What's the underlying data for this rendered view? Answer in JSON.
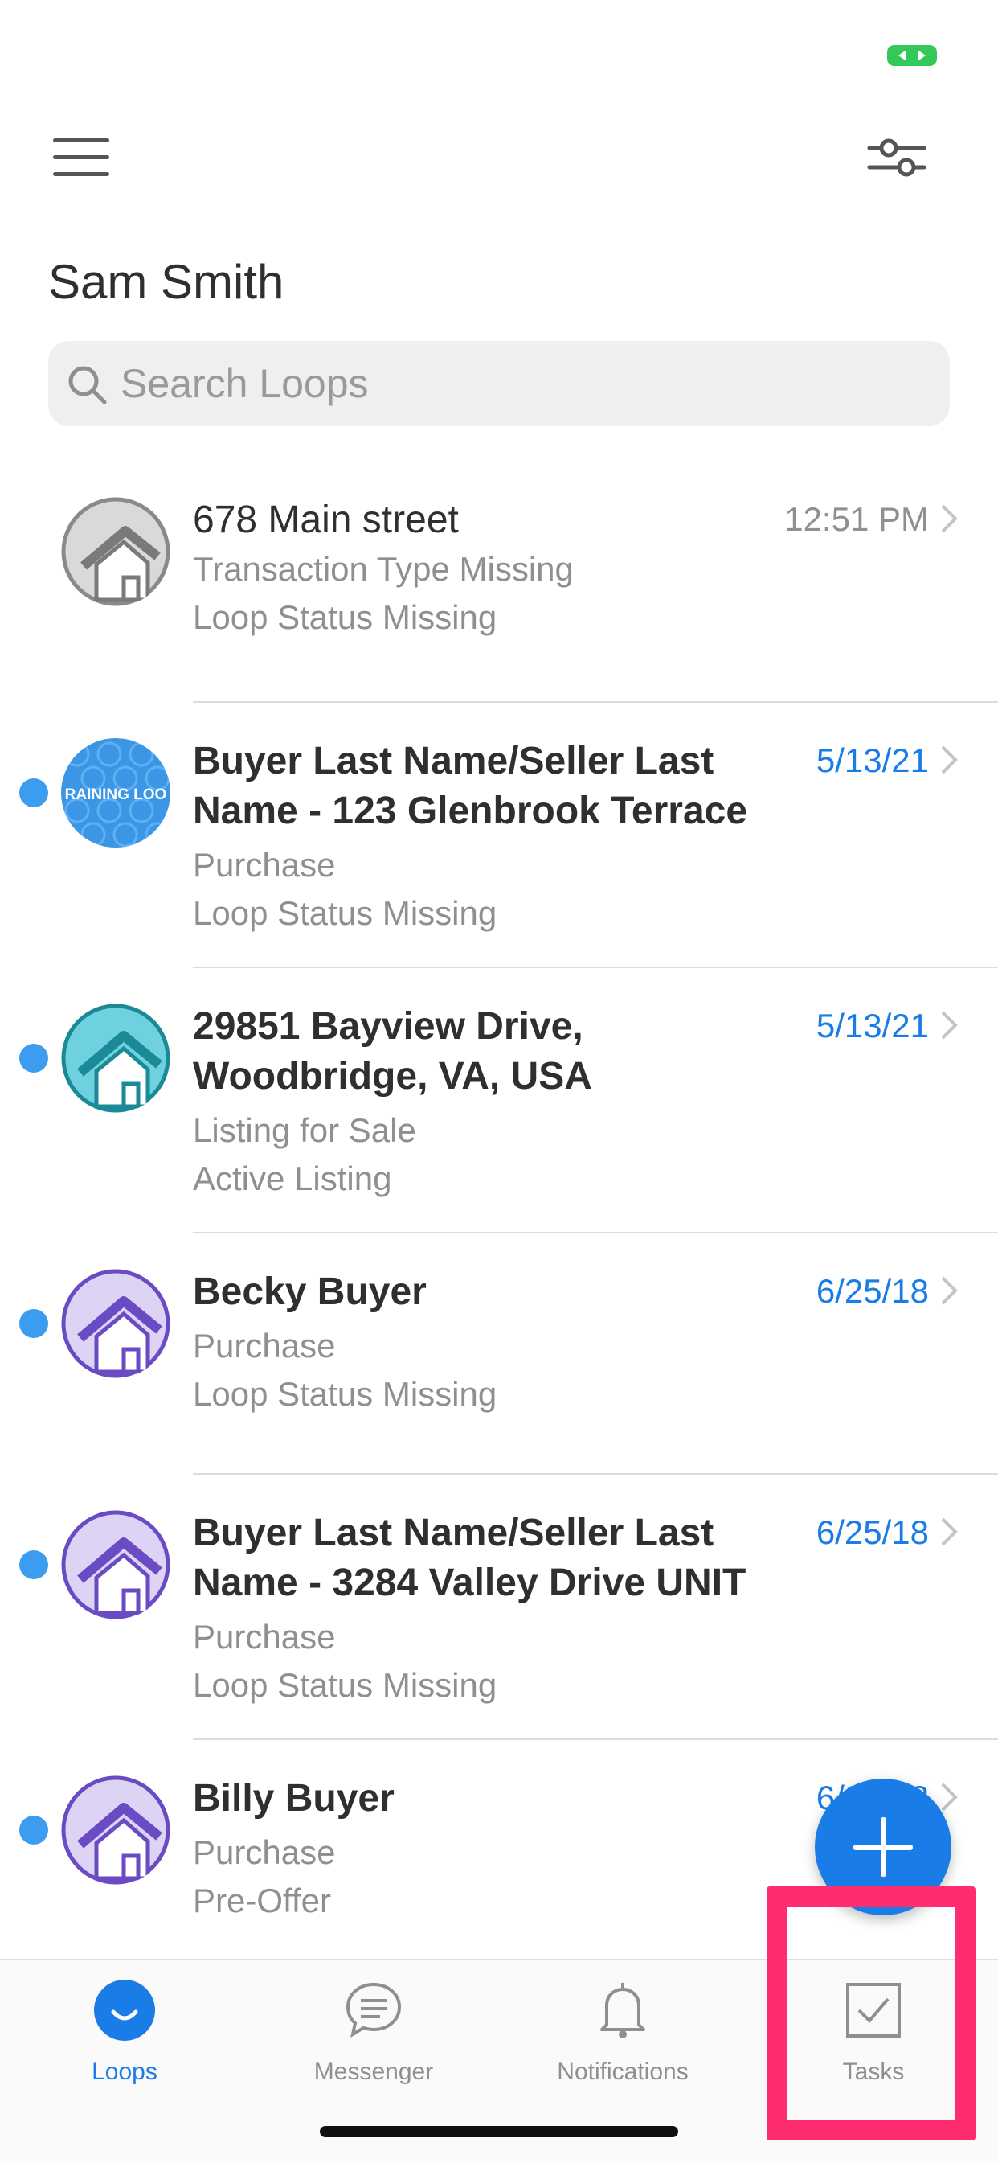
{
  "header": {
    "user_name": "Sam Smith"
  },
  "search": {
    "placeholder": "Search Loops",
    "value": ""
  },
  "loops": [
    {
      "title": "678 Main street",
      "line1": "Transaction Type Missing",
      "line2": "Loop Status Missing",
      "date": "12:51 PM",
      "unread": false,
      "avatar": "gray-house-icon"
    },
    {
      "title": "Buyer Last Name/Seller Last Name - 123 Glenbrook Terrace",
      "line1": "Purchase",
      "line2": "Loop Status Missing",
      "date": "5/13/21",
      "unread": true,
      "avatar": "training-loop-badge",
      "avatar_text": "RAINING LOO"
    },
    {
      "title": "29851 Bayview Drive, Woodbridge, VA, USA",
      "line1": "Listing for Sale",
      "line2": "Active Listing",
      "date": "5/13/21",
      "unread": true,
      "avatar": "teal-house-icon"
    },
    {
      "title": "Becky Buyer",
      "line1": "Purchase",
      "line2": "Loop Status Missing",
      "date": "6/25/18",
      "unread": true,
      "avatar": "purple-house-icon"
    },
    {
      "title": "Buyer Last Name/Seller Last Name - 3284 Valley Drive UNIT",
      "line1": "Purchase",
      "line2": "Loop Status Missing",
      "date": "6/25/18",
      "unread": true,
      "avatar": "purple-house-icon"
    },
    {
      "title": "Billy Buyer",
      "line1": "Purchase",
      "line2": "Pre-Offer",
      "date": "6/25/18",
      "unread": true,
      "avatar": "purple-house-icon"
    }
  ],
  "tabs": [
    {
      "label": "Loops",
      "icon": "loops-icon",
      "active": true
    },
    {
      "label": "Messenger",
      "icon": "messenger-icon",
      "active": false
    },
    {
      "label": "Notifications",
      "icon": "bell-icon",
      "active": false
    },
    {
      "label": "Tasks",
      "icon": "tasks-checkbox-icon",
      "active": false
    }
  ],
  "colors": {
    "accent": "#1a7ce6",
    "unread_dot": "#3b9cf0",
    "highlight": "#ff2d6f",
    "status_green": "#34c759"
  }
}
